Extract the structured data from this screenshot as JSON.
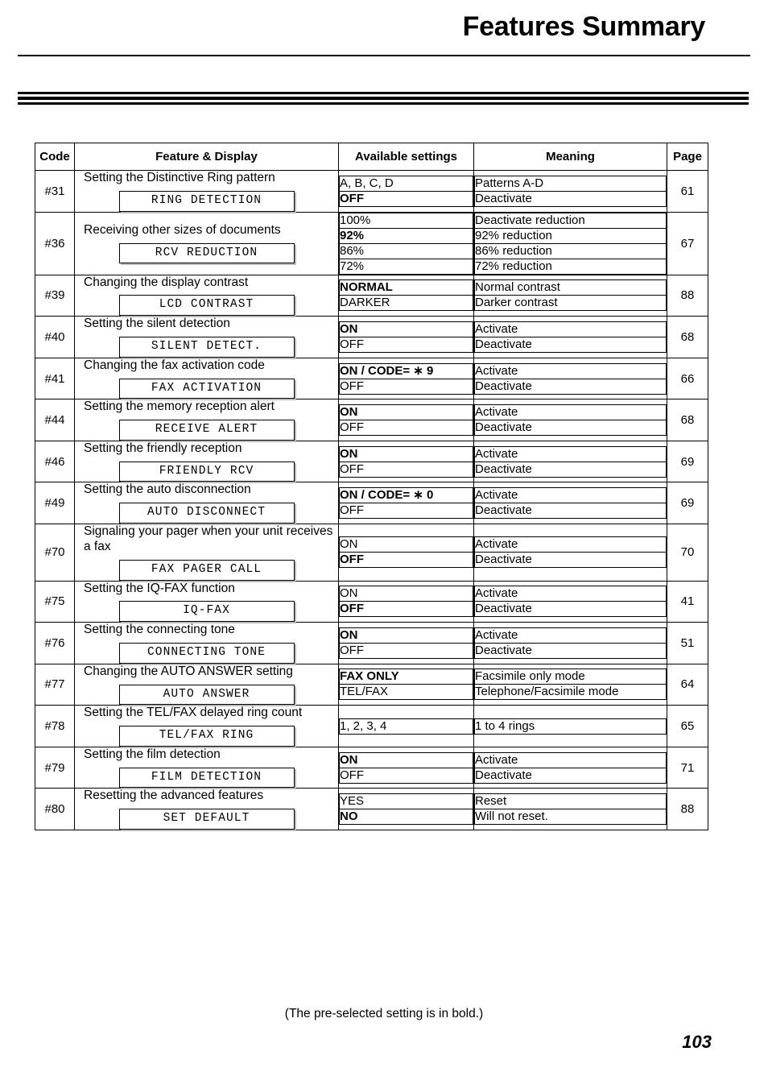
{
  "header": {
    "title": "Features Summary"
  },
  "table": {
    "columns": [
      "Code",
      "Feature & Display",
      "Available settings",
      "Meaning",
      "Page"
    ],
    "rows": [
      {
        "code": "#31",
        "feature": "Setting the Distinctive Ring pattern",
        "display": "RING DETECTION",
        "page": "61",
        "settings": [
          {
            "value": "A, B, C, D",
            "bold": false,
            "meaning": "Patterns A-D"
          },
          {
            "value": "OFF",
            "bold": true,
            "meaning": "Deactivate"
          }
        ]
      },
      {
        "code": "#36",
        "feature": "Receiving other sizes of documents",
        "display": "RCV REDUCTION",
        "page": "67",
        "settings": [
          {
            "value": "100%",
            "bold": false,
            "meaning": "Deactivate reduction"
          },
          {
            "value": "92%",
            "bold": true,
            "meaning": "92% reduction"
          },
          {
            "value": "86%",
            "bold": false,
            "meaning": "86% reduction"
          },
          {
            "value": "72%",
            "bold": false,
            "meaning": "72% reduction"
          }
        ]
      },
      {
        "code": "#39",
        "feature": "Changing the display contrast",
        "display": "LCD CONTRAST",
        "page": "88",
        "settings": [
          {
            "value": "NORMAL",
            "bold": true,
            "meaning": "Normal contrast"
          },
          {
            "value": "DARKER",
            "bold": false,
            "meaning": "Darker contrast"
          }
        ]
      },
      {
        "code": "#40",
        "feature": "Setting the silent detection",
        "display": "SILENT DETECT.",
        "page": "68",
        "settings": [
          {
            "value": "ON",
            "bold": true,
            "meaning": "Activate"
          },
          {
            "value": "OFF",
            "bold": false,
            "meaning": "Deactivate"
          }
        ]
      },
      {
        "code": "#41",
        "feature": "Changing the fax activation code",
        "display": "FAX ACTIVATION",
        "page": "66",
        "settings": [
          {
            "value": "ON / CODE= ∗ 9",
            "bold": true,
            "meaning": "Activate"
          },
          {
            "value": "OFF",
            "bold": false,
            "meaning": "Deactivate"
          }
        ]
      },
      {
        "code": "#44",
        "feature": "Setting the memory reception alert",
        "display": "RECEIVE ALERT",
        "page": "68",
        "settings": [
          {
            "value": "ON",
            "bold": true,
            "meaning": "Activate"
          },
          {
            "value": "OFF",
            "bold": false,
            "meaning": "Deactivate"
          }
        ]
      },
      {
        "code": "#46",
        "feature": "Setting the friendly reception",
        "display": "FRIENDLY RCV",
        "page": "69",
        "settings": [
          {
            "value": "ON",
            "bold": true,
            "meaning": "Activate"
          },
          {
            "value": "OFF",
            "bold": false,
            "meaning": "Deactivate"
          }
        ]
      },
      {
        "code": "#49",
        "feature": "Setting the auto disconnection",
        "display": "AUTO DISCONNECT",
        "page": "69",
        "settings": [
          {
            "value": "ON / CODE= ∗ 0",
            "bold": true,
            "meaning": "Activate"
          },
          {
            "value": "OFF",
            "bold": false,
            "meaning": "Deactivate"
          }
        ]
      },
      {
        "code": "#70",
        "feature": "Signaling your pager when your unit receives a fax",
        "display": "FAX PAGER CALL",
        "page": "70",
        "settings": [
          {
            "value": "ON",
            "bold": false,
            "meaning": "Activate"
          },
          {
            "value": "OFF",
            "bold": true,
            "meaning": "Deactivate"
          }
        ]
      },
      {
        "code": "#75",
        "feature": "Setting the IQ-FAX function",
        "display": "IQ-FAX",
        "page": "41",
        "settings": [
          {
            "value": "ON",
            "bold": false,
            "meaning": "Activate"
          },
          {
            "value": "OFF",
            "bold": true,
            "meaning": "Deactivate"
          }
        ]
      },
      {
        "code": "#76",
        "feature": "Setting the connecting tone",
        "display": "CONNECTING TONE",
        "page": "51",
        "settings": [
          {
            "value": "ON",
            "bold": true,
            "meaning": "Activate"
          },
          {
            "value": "OFF",
            "bold": false,
            "meaning": "Deactivate"
          }
        ]
      },
      {
        "code": "#77",
        "feature": "Changing the AUTO ANSWER setting",
        "display": "AUTO ANSWER",
        "page": "64",
        "settings": [
          {
            "value": "FAX ONLY",
            "bold": true,
            "meaning": "Facsimile only mode"
          },
          {
            "value": "TEL/FAX",
            "bold": false,
            "meaning": "Telephone/Facsimile mode"
          }
        ]
      },
      {
        "code": "#78",
        "feature": "Setting the TEL/FAX delayed ring count",
        "display": "TEL/FAX RING",
        "page": "65",
        "settings": [
          {
            "value": "1, 2, 3, 4",
            "bold": false,
            "meaning": "1 to 4 rings"
          }
        ]
      },
      {
        "code": "#79",
        "feature": "Setting the film detection",
        "display": "FILM DETECTION",
        "page": "71",
        "settings": [
          {
            "value": "ON",
            "bold": true,
            "meaning": "Activate"
          },
          {
            "value": "OFF",
            "bold": false,
            "meaning": "Deactivate"
          }
        ]
      },
      {
        "code": "#80",
        "feature": "Resetting the advanced features",
        "display": "SET DEFAULT",
        "page": "88",
        "settings": [
          {
            "value": "YES",
            "bold": false,
            "meaning": "Reset"
          },
          {
            "value": "NO",
            "bold": true,
            "meaning": "Will not reset."
          }
        ]
      }
    ]
  },
  "footer": {
    "note": "(The pre-selected setting is in bold.)",
    "page_number": "103"
  }
}
